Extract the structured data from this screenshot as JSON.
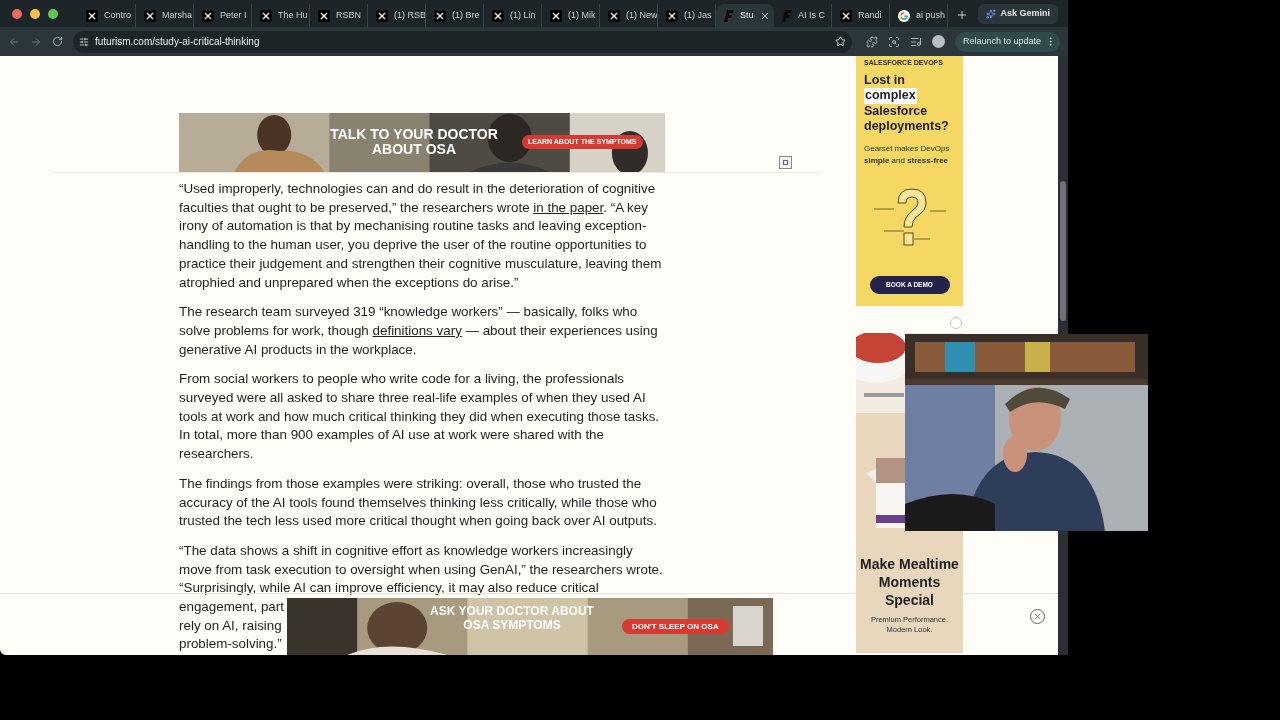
{
  "tabs": [
    {
      "label": "Contro",
      "kind": "x",
      "selected": false
    },
    {
      "label": "Marsha",
      "kind": "x",
      "selected": false
    },
    {
      "label": "Peter I",
      "kind": "x",
      "selected": false
    },
    {
      "label": "The Hu",
      "kind": "x",
      "selected": false
    },
    {
      "label": "RSBN",
      "kind": "x",
      "selected": false
    },
    {
      "label": "(1) RSB",
      "kind": "x",
      "selected": false
    },
    {
      "label": "(1) Bre",
      "kind": "x",
      "selected": false
    },
    {
      "label": "(1) Lin",
      "kind": "x",
      "selected": false
    },
    {
      "label": "(1) Mik",
      "kind": "x",
      "selected": false
    },
    {
      "label": "(1) New",
      "kind": "x",
      "selected": false
    },
    {
      "label": "(1) Jas",
      "kind": "x",
      "selected": false
    },
    {
      "label": "Stu",
      "kind": "f",
      "selected": true
    },
    {
      "label": "AI Is C",
      "kind": "f",
      "selected": false
    },
    {
      "label": "Randi",
      "kind": "x",
      "selected": false
    },
    {
      "label": "ai push",
      "kind": "google",
      "selected": false
    }
  ],
  "ask_button": "Ask Gemini",
  "address": "futurism.com/study-ai-critical-thinking",
  "relaunch_button": "Relaunch to update",
  "top_ad": {
    "headline": "TALK TO YOUR DOCTOR ABOUT OSA",
    "cta": "LEARN ABOUT THE SYMPTOMS"
  },
  "article": {
    "paragraphs": [
      {
        "segments": [
          {
            "text": "“Used improperly, technologies can and do result in the deterioration of cognitive faculties that ought to be preserved,” the researchers wrote ",
            "link": false
          },
          {
            "text": "in the paper",
            "link": true
          },
          {
            "text": ". “A key irony of automation is that by mechanising routine tasks and leaving exception-handling to the human user, you deprive the user of the routine opportunities to practice their judgement and strengthen their cognitive musculature, leaving them atrophied and unprepared when the exceptions do arise.”",
            "link": false
          }
        ]
      },
      {
        "segments": [
          {
            "text": "The research team surveyed 319 “knowledge workers” — basically, folks who solve problems for work, though ",
            "link": false
          },
          {
            "text": "definitions vary",
            "link": true
          },
          {
            "text": " — about their experiences using generative AI products in the workplace.",
            "link": false
          }
        ]
      },
      {
        "segments": [
          {
            "text": "From social workers to people who write code for a living, the professionals surveyed were all asked to share three real-life examples of when they used AI tools at work and how much critical thinking they did when executing those tasks. In total, more than 900 examples of AI use at work were shared with the researchers.",
            "link": false
          }
        ]
      },
      {
        "segments": [
          {
            "text": "The findings from those examples were striking: overall, those who trusted the accuracy of the AI tools found themselves thinking less critically, while those who trusted the tech less used more critical thought when going back over AI outputs.",
            "link": false
          }
        ]
      }
    ],
    "last_paragraph": {
      "text": "“The data shows a shift in cognitive effort as knowledge workers increasingly move from task execution to oversight when using GenAI,” the researchers wrote.",
      "lines": [
        "“Surprisingly, while AI can improve efficiency, it may also reduce critical",
        "engagement, part",
        "rely on AI, raising",
        "problem-solving.”"
      ]
    }
  },
  "side_ads": [
    {
      "kind": "devops",
      "eyebrow": "SALESFORCE DEVOPS",
      "headline": [
        {
          "text": "Lost in",
          "highlighted": false
        },
        {
          "text": "complex",
          "highlighted": true
        },
        {
          "text": "Salesforce deployments?",
          "highlighted": false
        }
      ],
      "body": "Gearset makes DevOps **simple** and **stress-free**",
      "cta": "BOOK A DEMO"
    },
    {
      "kind": "product",
      "headline": "Make Mealtime Moments Special",
      "body": "Premium Performance. Modern Look."
    }
  ],
  "bottom_ad": {
    "headline": "ASK YOUR DOCTOR ABOUT OSA SYMPTOMS",
    "cta": "DON'T SLEEP ON OSA"
  }
}
